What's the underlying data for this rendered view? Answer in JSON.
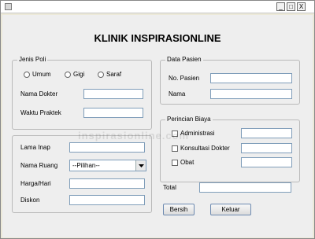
{
  "window": {
    "controls": [
      "_",
      "□",
      "X"
    ]
  },
  "app_title": "KLINIK INSPIRASIONLINE",
  "watermark": "inspirasionline.com",
  "jenis_poli": {
    "legend": "Jenis Poli",
    "options": [
      "Umum",
      "Gigi",
      "Saraf"
    ],
    "nama_dokter_label": "Nama Dokter",
    "nama_dokter_value": "",
    "waktu_praktek_label": "Waktu Praktek",
    "waktu_praktek_value": ""
  },
  "data_pasien": {
    "legend": "Data Pasien",
    "no_pasien_label": "No. Pasien",
    "no_pasien_value": "",
    "nama_label": "Nama",
    "nama_value": ""
  },
  "inap": {
    "lama_inap_label": "Lama Inap",
    "lama_inap_value": "",
    "nama_ruang_label": "Nama Ruang",
    "nama_ruang_selected": "--Pilihan--",
    "harga_label": "Harga/Hari",
    "harga_value": "",
    "diskon_label": "Diskon",
    "diskon_value": ""
  },
  "perincian_biaya": {
    "legend": "Perincian Biaya",
    "items": [
      "Administrasi",
      "Konsultasi Dokter",
      "Obat"
    ]
  },
  "total": {
    "label": "Total",
    "value": ""
  },
  "buttons": {
    "bersih": "Bersih",
    "keluar": "Keluar"
  }
}
